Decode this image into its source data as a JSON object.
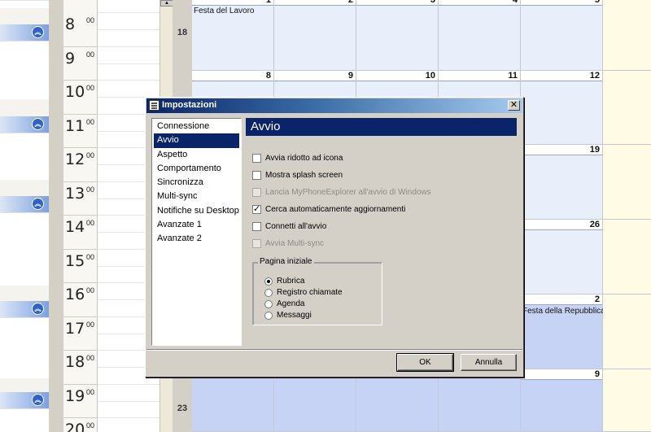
{
  "calendar": {
    "hours": [
      "8",
      "9",
      "10",
      "11",
      "12",
      "13",
      "14",
      "15",
      "16",
      "17",
      "18",
      "19",
      "20"
    ],
    "minutes": "00",
    "weeks": [
      "18",
      "23"
    ],
    "day_numbers": {
      "row0": [
        "1",
        "2",
        "3",
        "4",
        "5"
      ],
      "row1": [
        "8",
        "9",
        "10",
        "11",
        "12"
      ],
      "row2_last": "19",
      "row3_last": "26",
      "row4_last": "2",
      "row5_last": "9"
    },
    "events": {
      "may1": "Festa del Lavoro",
      "june2": "Festa della Repubblica"
    }
  },
  "dialog": {
    "title": "Impostazioni",
    "close_label": "✕",
    "nav_items": [
      "Connessione",
      "Avvio",
      "Aspetto",
      "Comportamento",
      "Sincronizza",
      "Multi-sync",
      "Notifiche su Desktop",
      "Avanzate 1",
      "Avanzate 2"
    ],
    "selected_nav": "Avvio",
    "panel_title": "Avvio",
    "options": [
      {
        "label": "Avvia ridotto ad icona",
        "checked": false,
        "enabled": true
      },
      {
        "label": "Mostra splash screen",
        "checked": false,
        "enabled": true
      },
      {
        "label": "Lancia MyPhoneExplorer all'avvio di Windows",
        "checked": false,
        "enabled": false
      },
      {
        "label": "Cerca automaticamente aggiornamenti",
        "checked": true,
        "enabled": true
      },
      {
        "label": "Connetti all'avvio",
        "checked": false,
        "enabled": true
      },
      {
        "label": "Avvia Multi-sync",
        "checked": false,
        "enabled": false
      }
    ],
    "start_page": {
      "label": "Pagina iniziale",
      "options": [
        "Rubrica",
        "Registro chiamate",
        "Agenda",
        "Messaggi"
      ],
      "selected": "Rubrica"
    },
    "ok_label": "OK",
    "cancel_label": "Annulla"
  }
}
